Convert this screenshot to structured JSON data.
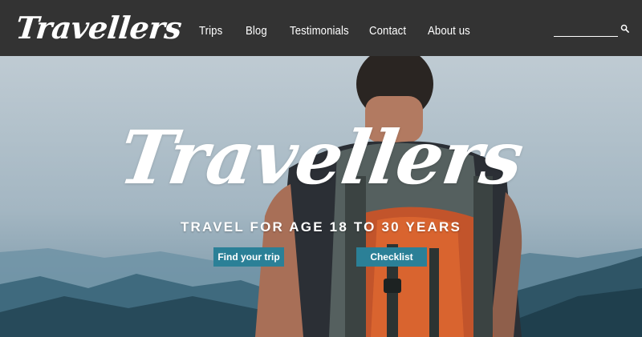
{
  "brand": {
    "logo_text": "Travellers"
  },
  "nav": {
    "items": [
      {
        "label": "Trips"
      },
      {
        "label": "Blog"
      },
      {
        "label": "Testimonials"
      },
      {
        "label": "Contact"
      },
      {
        "label": "About us"
      }
    ]
  },
  "search": {
    "value": "",
    "placeholder": "",
    "icon": "search-icon"
  },
  "hero": {
    "title": "Travellers",
    "subtitle": "TRAVEL FOR AGE 18 TO 30 YEARS",
    "buttons": [
      {
        "label": "Find your trip"
      },
      {
        "label": "Checklist"
      }
    ]
  },
  "colors": {
    "navbar": "#333333",
    "button": "#2b8097",
    "text": "#ffffff"
  }
}
